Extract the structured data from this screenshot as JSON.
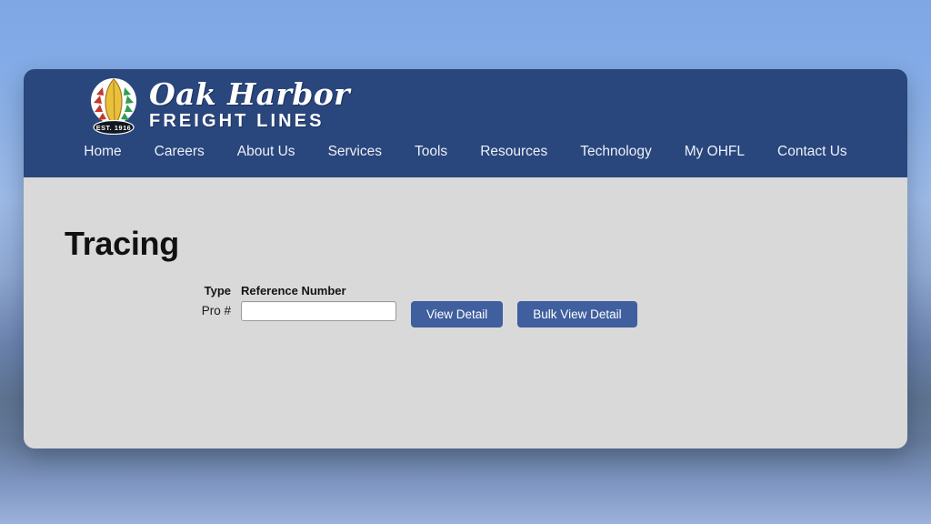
{
  "window": {
    "brand": {
      "logo_icon": "oak-harbor-leaf-emblem",
      "name_line1": "Oak Harbor",
      "name_line2": "FREIGHT LINES",
      "established_badge": "EST. 1916"
    },
    "nav": {
      "items": [
        {
          "label": "Home"
        },
        {
          "label": "Careers"
        },
        {
          "label": "About Us"
        },
        {
          "label": "Services"
        },
        {
          "label": "Tools"
        },
        {
          "label": "Resources"
        },
        {
          "label": "Technology"
        },
        {
          "label": "My OHFL"
        },
        {
          "label": "Contact Us"
        }
      ]
    },
    "page": {
      "title": "Tracing",
      "form": {
        "type_header": "Type",
        "type_value": "Pro #",
        "reference_header": "Reference Number",
        "reference_value": "",
        "reference_placeholder": "",
        "view_detail_label": "View Detail",
        "bulk_view_detail_label": "Bulk View Detail"
      }
    }
  },
  "colors": {
    "header_navy": "#29467D",
    "button_blue": "#3F5F9E",
    "page_gray": "#D9D9D9",
    "logo_leaf_gold": "#E8C13C",
    "logo_leaf_red": "#C0392B",
    "logo_leaf_green": "#2F9E4F"
  }
}
